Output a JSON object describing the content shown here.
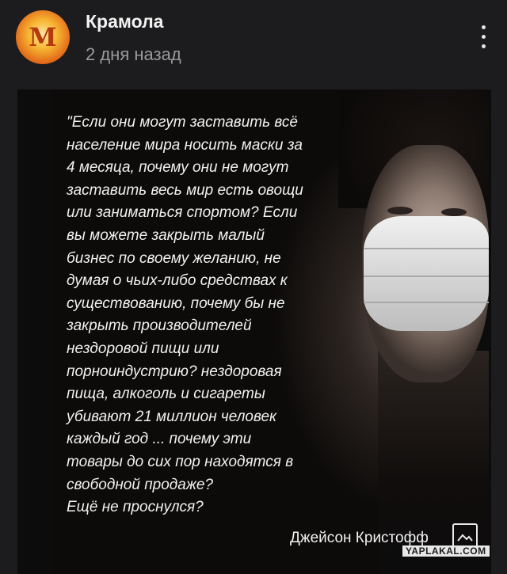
{
  "header": {
    "channel_name": "Крамола",
    "post_time": "2 дня назад",
    "avatar_letter": "M",
    "more_icon": "more-vertical-icon"
  },
  "post_image": {
    "quote_lines": [
      "\"Если они могут заставить всё",
      "население мира носить маски за",
      "4 месяца, почему они не могут",
      "заставить весь мир есть овощи",
      "или заниматься спортом? Если",
      "вы можете закрыть малый",
      "бизнес по своему желанию, не",
      "думая о чьих-либо средствах к",
      "существованию, почему бы не",
      "закрыть производителей",
      "нездоровой пищи или",
      "порноиндустрию? нездоровая",
      "пища, алкоголь и сигареты",
      "убивают 21 миллион человек",
      "каждый год ... почему эти",
      "товары до сих пор находятся в",
      "свободной продаже?",
      "Ещё не проснулся?"
    ],
    "author": "Джейсон Кристофф",
    "watermark": "YAPLAKAL.COM",
    "image_icon": "image-icon"
  }
}
